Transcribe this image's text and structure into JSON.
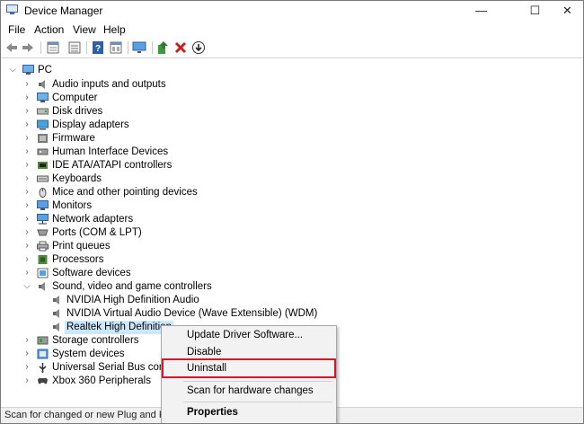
{
  "window": {
    "title": "Device Manager",
    "controls": {
      "minimize": "—",
      "maximize": "☐",
      "close": "✕"
    }
  },
  "menu": [
    "File",
    "Action",
    "View",
    "Help"
  ],
  "toolbar": [
    "back",
    "forward",
    "properties-sheet",
    "list-view",
    "help",
    "details-view",
    "monitor",
    "update-driver",
    "uninstall",
    "scan-download"
  ],
  "tree": {
    "root": "PC",
    "categories": [
      "Audio inputs and outputs",
      "Computer",
      "Disk drives",
      "Display adapters",
      "Firmware",
      "Human Interface Devices",
      "IDE ATA/ATAPI controllers",
      "Keyboards",
      "Mice and other pointing devices",
      "Monitors",
      "Network adapters",
      "Ports (COM & LPT)",
      "Print queues",
      "Processors",
      "Software devices",
      "Sound, video and game controllers"
    ],
    "sound_children": [
      "NVIDIA High Definition Audio",
      "NVIDIA Virtual Audio Device (Wave Extensible) (WDM)",
      "Realtek High Definition"
    ],
    "categories_after": [
      "Storage controllers",
      "System devices",
      "Universal Serial Bus control",
      "Xbox 360 Peripherals"
    ]
  },
  "context_menu": {
    "items": [
      "Update Driver Software...",
      "Disable",
      "Uninstall",
      "Scan for hardware changes",
      "Properties"
    ],
    "highlight_color": "#d0182a"
  },
  "status": "Scan for changed or new Plug and Play"
}
